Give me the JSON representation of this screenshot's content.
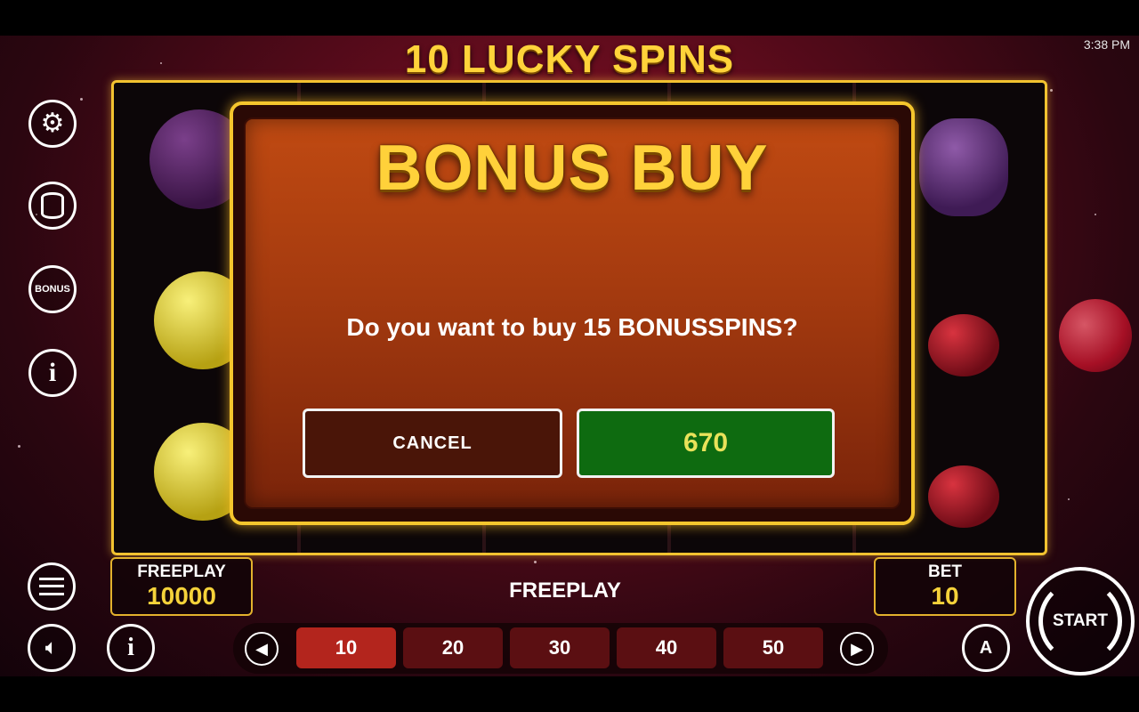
{
  "status_bar": {
    "time": "3:38 PM"
  },
  "game_title": "10 LUCKY SPINS",
  "modal": {
    "title": "BONUS BUY",
    "question": "Do you want to buy 15 BONUSSPINS?",
    "cancel_label": "CANCEL",
    "buy_price": "670"
  },
  "left_controls": {
    "settings_icon": "gear-icon",
    "stake_icon": "coin-stack-icon",
    "bonus_label": "BONUS",
    "info_icon": "info-icon"
  },
  "balance": {
    "label": "FREEPLAY",
    "value": "10000"
  },
  "mode_label": "FREEPLAY",
  "bet": {
    "label": "BET",
    "value": "10"
  },
  "bet_options": [
    "10",
    "20",
    "30",
    "40",
    "50"
  ],
  "selected_bet": "10",
  "start_label": "START",
  "autoplay_letter": "A",
  "colors": {
    "gold": "#f2c230",
    "modal_orange": "#b5420f",
    "buy_green": "#0e6b10",
    "cancel_brown": "#4a1508",
    "active_bet": "#b3251d"
  }
}
